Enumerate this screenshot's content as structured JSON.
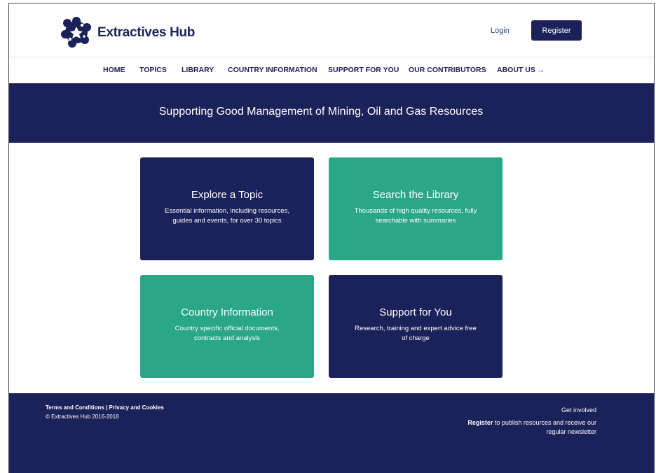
{
  "header": {
    "brand": "Extractives Hub",
    "login": "Login",
    "register": "Register"
  },
  "nav": {
    "items": [
      {
        "label": "HOME"
      },
      {
        "label": "TOPICS"
      },
      {
        "label": "LIBRARY"
      },
      {
        "label": "COUNTRY INFORMATION"
      },
      {
        "label": "SUPPORT FOR YOU"
      },
      {
        "label": "OUR CONTRIBUTORS"
      },
      {
        "label": "ABOUT US →"
      }
    ]
  },
  "hero": {
    "title": "Supporting Good Management of Mining, Oil and Gas Resources"
  },
  "tiles": [
    {
      "title": "Explore a Topic",
      "description": "Essential information, including resources, guides and events, for over 30 topics"
    },
    {
      "title": "Search the Library",
      "description": "Thousands of high quality resources, fully searchable with summaries"
    },
    {
      "title": "Country Information",
      "description": "Country specific official documents, contracts and analysis"
    },
    {
      "title": "Support for You",
      "description": "Research, training and expert advice free of charge"
    }
  ],
  "footer": {
    "terms": "Terms and Conditions",
    "separator": " | ",
    "privacy": "Privacy and Cookies",
    "copyright": "© Extractives Hub 2016-2018",
    "get_involved": "Get involved",
    "register_link": "Register",
    "register_text": " to publish resources and receive our regular newsletter"
  },
  "colors": {
    "navy": "#1b2159",
    "teal": "#2aa688",
    "white": "#ffffff"
  }
}
